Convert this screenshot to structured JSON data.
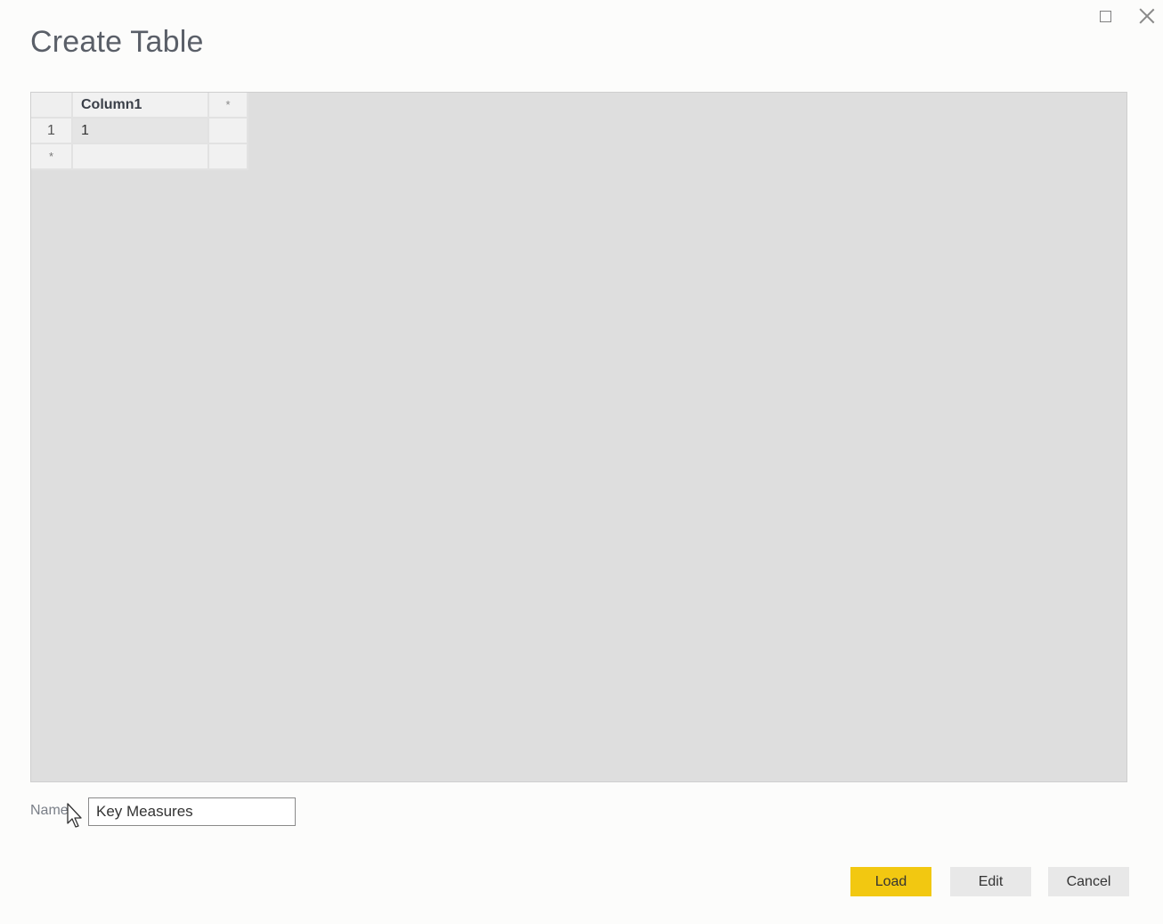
{
  "dialog": {
    "title": "Create Table",
    "window_controls": {
      "maximize": "maximize-icon",
      "close": "close-icon"
    }
  },
  "grid": {
    "columns": [
      "Column1"
    ],
    "add_column_marker": "*",
    "rows": [
      {
        "row_number": "1",
        "cells": [
          "1"
        ]
      }
    ],
    "new_row_marker": "*"
  },
  "name_field": {
    "label": "Name",
    "value": "Key Measures"
  },
  "buttons": {
    "load": "Load",
    "edit": "Edit",
    "cancel": "Cancel"
  },
  "colors": {
    "primary_button": "#f2c811",
    "secondary_button": "#e8e8e8",
    "grid_background": "#dedede"
  }
}
